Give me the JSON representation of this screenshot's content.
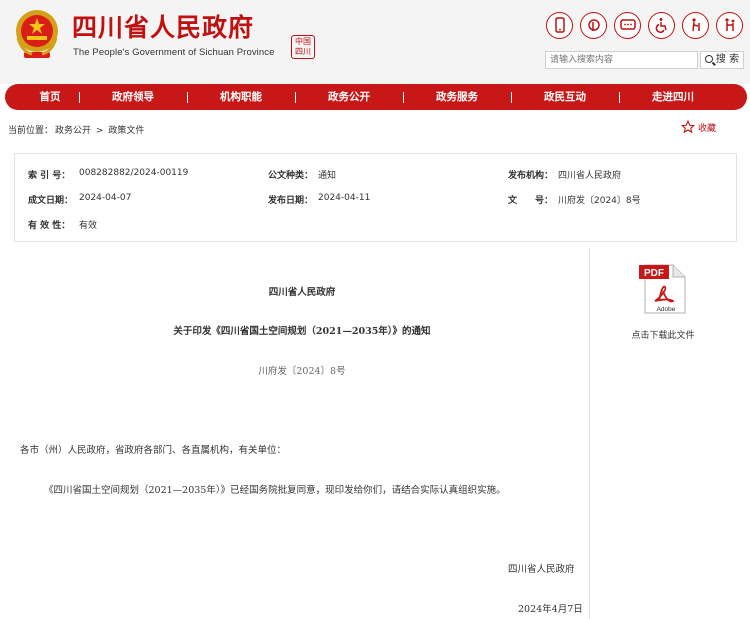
{
  "header": {
    "title": "四川省人民政府",
    "subtitle": "The People's Government of Sichuan Province",
    "seal_text": "中国四川",
    "search": {
      "placeholder": "请输入搜索内容",
      "button_label": "搜 索"
    },
    "icons": [
      "mobile-icon",
      "weibo-icon",
      "wechat-icon",
      "accessibility-icon",
      "elderly-care-icon",
      "family-icon"
    ]
  },
  "nav": {
    "items": [
      {
        "label": "首页"
      },
      {
        "label": "政府领导"
      },
      {
        "label": "机构职能"
      },
      {
        "label": "政务公开"
      },
      {
        "label": "政务服务"
      },
      {
        "label": "政民互动"
      },
      {
        "label": "走进四川"
      }
    ]
  },
  "breadcrumb": {
    "prefix": "当前位置：",
    "items": [
      "政务公开",
      "政策文件"
    ],
    "separator": ">"
  },
  "favorite_label": "收藏",
  "meta": {
    "index_label": "索 引 号：",
    "index_value": "008282882/2024-00119",
    "type_label": "公文种类：",
    "type_value": "通知",
    "publisher_label": "发布机构：",
    "publisher_value": "四川省人民政府",
    "created_label": "成文日期：",
    "created_value": "2024-04-07",
    "published_label": "发布日期：",
    "published_value": "2024-04-11",
    "docno_label": "文　　号：",
    "docno_value": "川府发〔2024〕8号",
    "validity_label": "有 效 性：",
    "validity_value": "有效"
  },
  "doc": {
    "issuer": "四川省人民政府",
    "title": "关于印发《四川省国土空间规划（2021—2035年）》的通知",
    "doc_number": "川府发〔2024〕8号",
    "salutation": "各市（州）人民政府，省政府各部门、各直属机构，有关单位：",
    "body": "《四川省国土空间规划（2021—2035年）》已经国务院批复同意，现印发给你们，请结合实际认真组织实施。",
    "signature": "四川省人民政府",
    "date": "2024年4月7日"
  },
  "side": {
    "pdf_label": "PDF",
    "adobe_label": "Adobe",
    "download_label": "点击下载此文件"
  },
  "colors": {
    "brand_red": "#c81717",
    "title_red": "#c01010"
  }
}
